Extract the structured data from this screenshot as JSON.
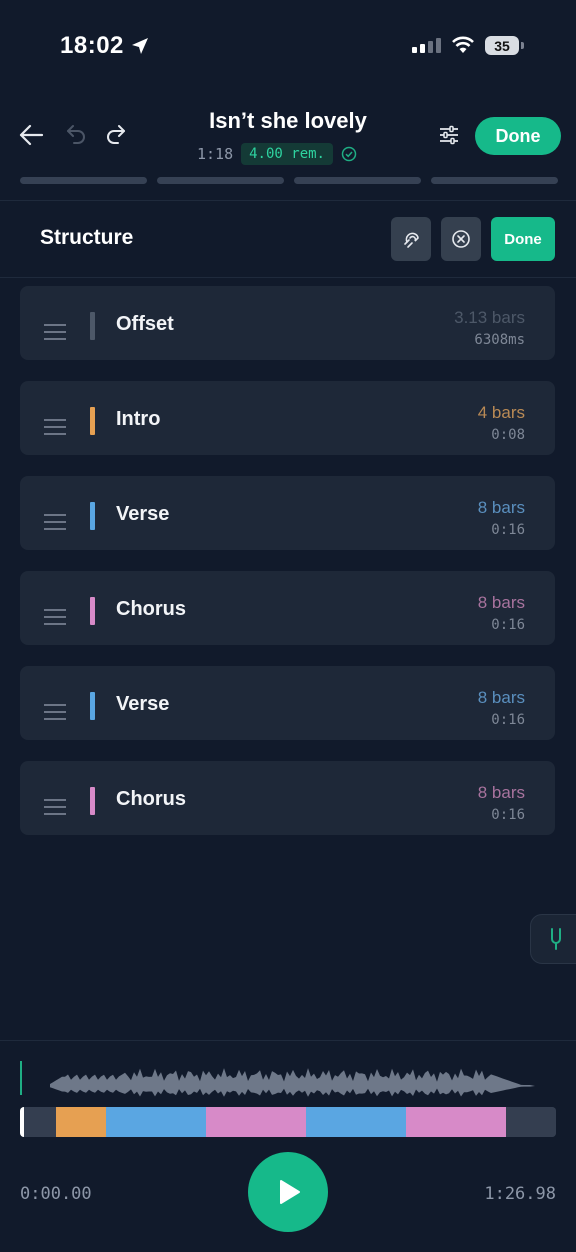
{
  "status": {
    "time": "18:02",
    "battery": "35"
  },
  "header": {
    "title": "Isn’t she lovely",
    "position": "1:18",
    "remaining": "4.00 rem.",
    "done_label": "Done"
  },
  "structure": {
    "title": "Structure",
    "done_label": "Done"
  },
  "sections": [
    {
      "label": "Offset",
      "bars": "3.13 bars",
      "duration": "6308ms",
      "color": "#4d5868",
      "bars_color": "#4d5868"
    },
    {
      "label": "Intro",
      "bars": "4 bars",
      "duration": "0:08",
      "color": "#e6a052",
      "bars_color": "#b98a55"
    },
    {
      "label": "Verse",
      "bars": "8 bars",
      "duration": "0:16",
      "color": "#5aa6e2",
      "bars_color": "#5a8fbe"
    },
    {
      "label": "Chorus",
      "bars": "8 bars",
      "duration": "0:16",
      "color": "#d78ac8",
      "bars_color": "#a8739e"
    },
    {
      "label": "Verse",
      "bars": "8 bars",
      "duration": "0:16",
      "color": "#5aa6e2",
      "bars_color": "#5a8fbe"
    },
    {
      "label": "Chorus",
      "bars": "8 bars",
      "duration": "0:16",
      "color": "#d78ac8",
      "bars_color": "#a8739e"
    }
  ],
  "player": {
    "start_time": "0:00.00",
    "end_time": "1:26.98",
    "segment_colors": [
      "#ffffff",
      "#343e50",
      "#e6a052",
      "#5aa6e2",
      "#d78ac8",
      "#5aa6e2",
      "#d78ac8",
      "#343e50"
    ],
    "segment_units": [
      0.5,
      4,
      6.3,
      12.5,
      12.5,
      12.5,
      12.5,
      6.2
    ]
  }
}
